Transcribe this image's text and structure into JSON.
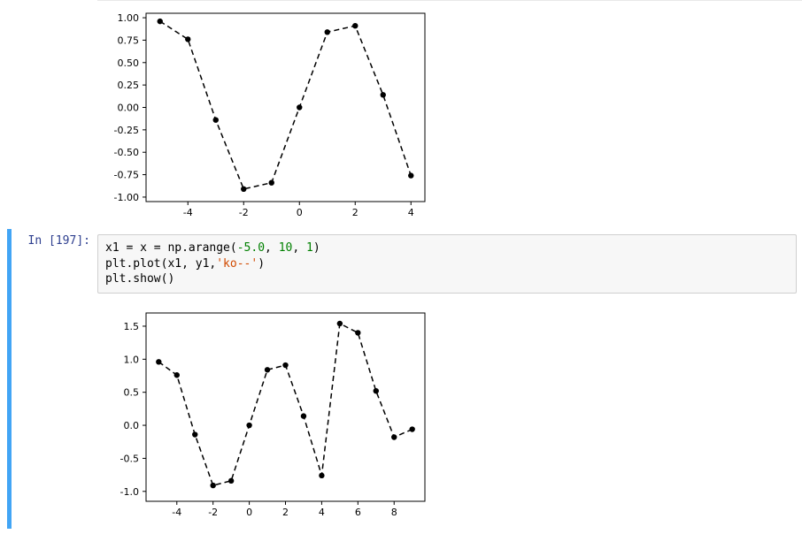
{
  "cells": {
    "top_output_prompt": "",
    "code_prompt_in": "In",
    "code_prompt_num": "[197]:",
    "code_line1_a": "x1 = x = np.arange(",
    "code_line1_neg5": "-5.0",
    "code_line1_c1": ", ",
    "code_line1_ten": "10",
    "code_line1_c2": ", ",
    "code_line1_one": "1",
    "code_line1_end": ")",
    "code_line2_a": "plt.plot(x1, y1,",
    "code_line2_str": "'ko--'",
    "code_line2_end": ")",
    "code_line3": "plt.show()"
  },
  "chart_data": [
    {
      "type": "line",
      "x": [
        -5,
        -4,
        -3,
        -2,
        -1,
        0,
        1,
        2,
        3,
        4
      ],
      "values": [
        0.96,
        0.76,
        -0.14,
        -0.91,
        -0.84,
        0.0,
        0.84,
        0.91,
        0.14,
        -0.76
      ],
      "x_ticks": [
        -4,
        -2,
        0,
        2,
        4
      ],
      "y_ticks": [
        -1.0,
        -0.75,
        -0.5,
        -0.25,
        0.0,
        0.25,
        0.5,
        0.75,
        1.0
      ],
      "xlim": [
        -5.5,
        4.5
      ],
      "ylim": [
        -1.05,
        1.05
      ],
      "marker": "o",
      "marker_color": "#000",
      "line_style": "dashed",
      "line_color": "#000"
    },
    {
      "type": "line",
      "x": [
        -5,
        -4,
        -3,
        -2,
        -1,
        0,
        1,
        2,
        3,
        4,
        5,
        6,
        7,
        8,
        9
      ],
      "values": [
        0.96,
        0.76,
        -0.14,
        -0.91,
        -0.84,
        0.0,
        0.84,
        0.91,
        0.14,
        -0.76,
        1.54,
        1.4,
        0.52,
        -0.18,
        -0.06
      ],
      "x_ticks": [
        -4,
        -2,
        0,
        2,
        4,
        6,
        8
      ],
      "y_ticks": [
        -1.0,
        -0.5,
        0.0,
        0.5,
        1.0,
        1.5
      ],
      "xlim": [
        -5.7,
        9.7
      ],
      "ylim": [
        -1.15,
        1.7
      ],
      "marker": "o",
      "marker_color": "#000",
      "line_style": "dashed",
      "line_color": "#000"
    }
  ]
}
